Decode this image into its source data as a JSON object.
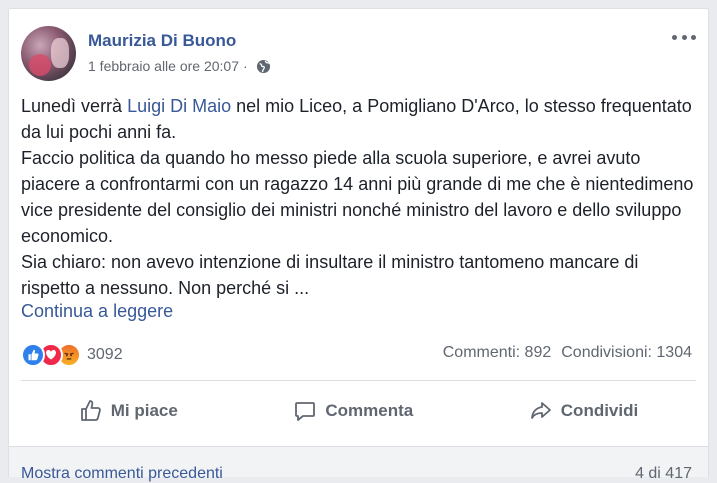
{
  "post": {
    "author": "Maurizia Di Buono",
    "timestamp": "1 febbraio alle ore 20:07",
    "separator": "·",
    "privacy_icon": "globe-icon",
    "text": {
      "line1_before": "Lunedì verrà ",
      "mention": "Luigi Di Maio",
      "line1_after": " nel mio Liceo, a Pomigliano D'Arco, lo stesso frequentato da lui pochi anni fa.",
      "paragraph2": "Faccio politica da quando ho messo piede alla scuola superiore, e avrei avuto piacere a confrontarmi con un ragazzo 14 anni più grande di me che è nientedimeno vice presidente del consiglio dei ministri nonché ministro del lavoro e dello sviluppo economico.",
      "paragraph3": "Sia chiaro: non avevo intenzione di insultare il ministro tantomeno mancare di rispetto a nessuno. Non perché si ..."
    },
    "continue_label": "Continua a leggere"
  },
  "reactions": {
    "icons": [
      "like-icon",
      "love-icon",
      "angry-icon"
    ],
    "count": "3092"
  },
  "stats": {
    "comments": "Commenti: 892",
    "shares": "Condivisioni: 1304"
  },
  "actions": {
    "like": "Mi piace",
    "comment": "Commenta",
    "share": "Condividi"
  },
  "comments_bar": {
    "show_previous": "Mostra commenti precedenti",
    "count": "4 di 417"
  },
  "colors": {
    "link": "#385898",
    "muted": "#606770",
    "like": "#2f80ed",
    "love": "#f0284a",
    "angry": "#f06d2b"
  }
}
